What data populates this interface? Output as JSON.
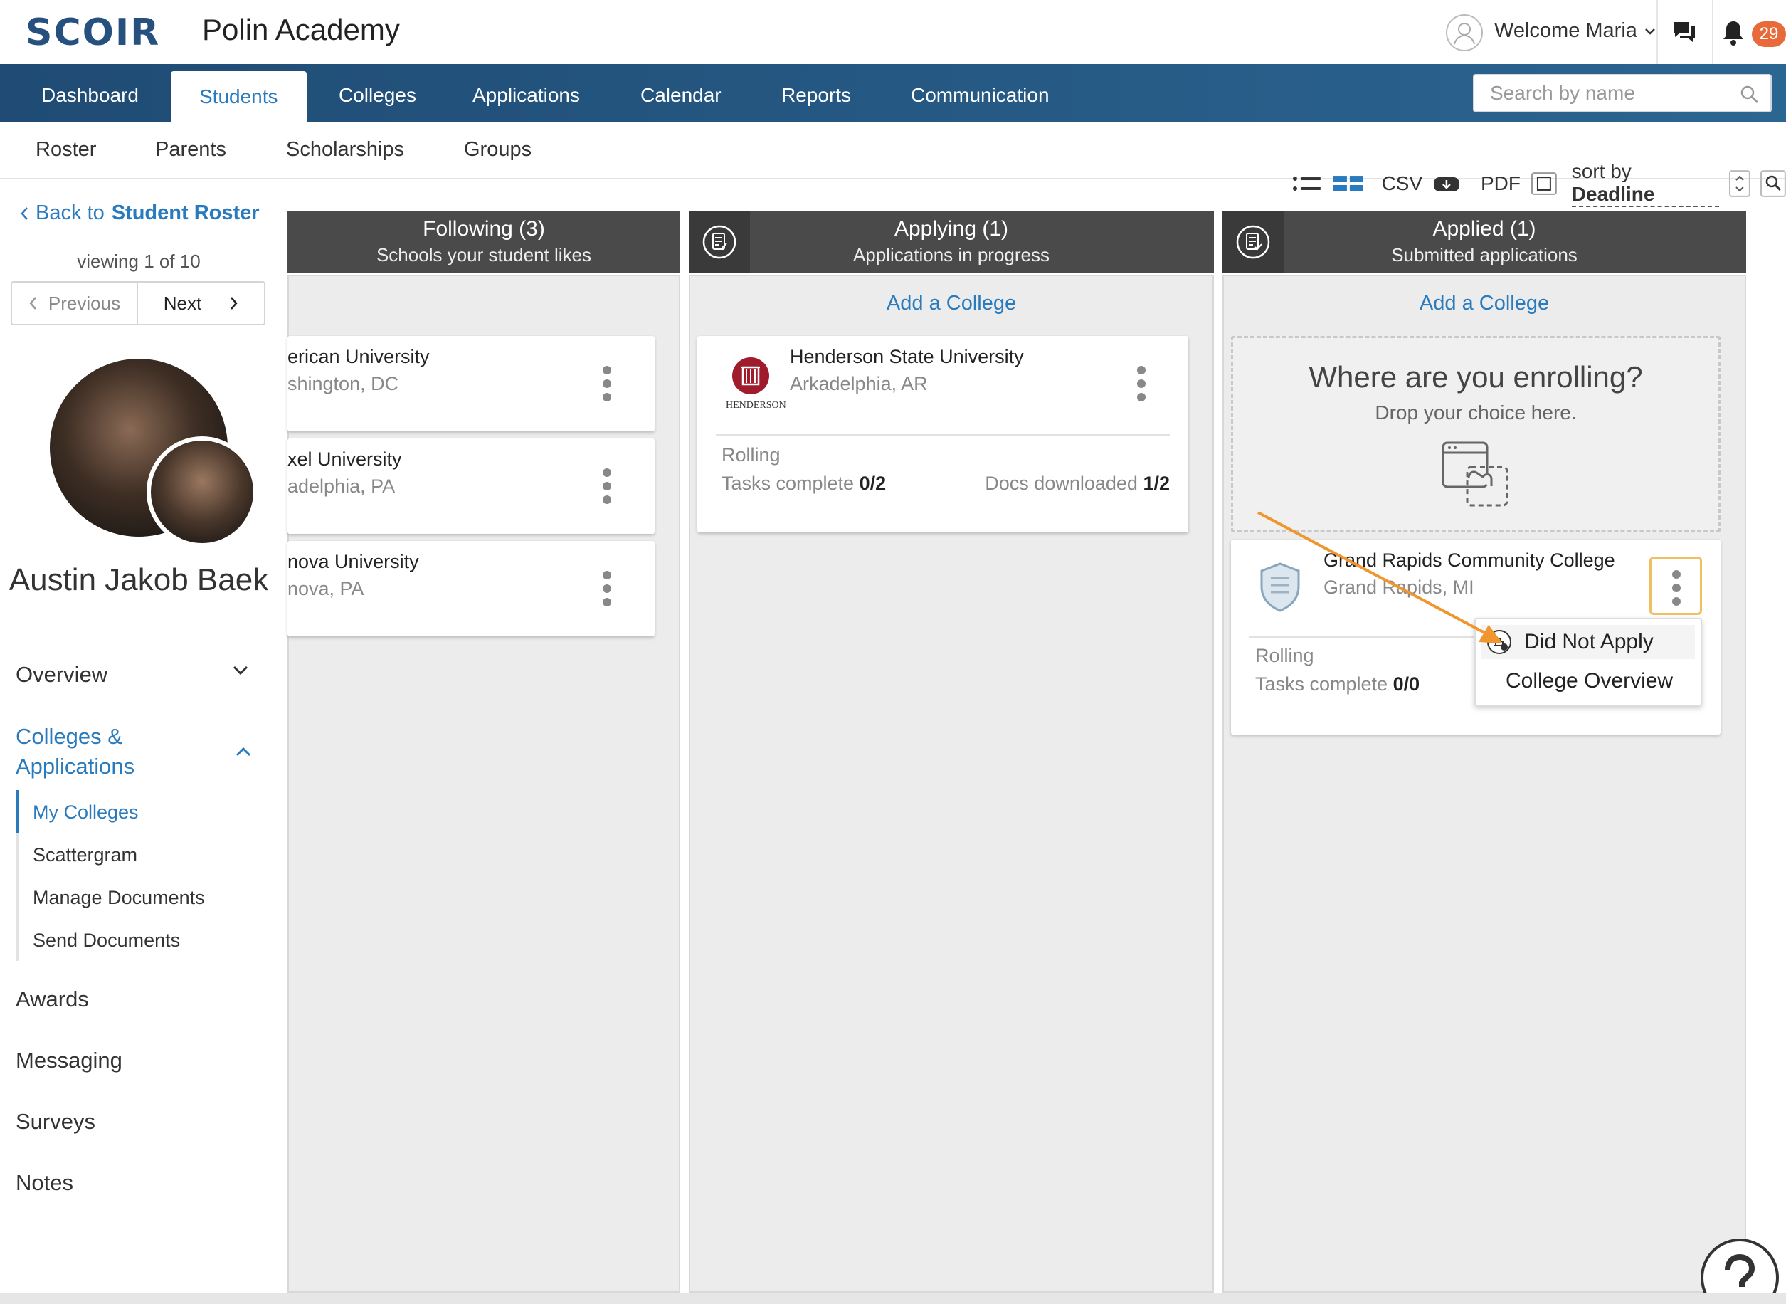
{
  "app": {
    "logo_text": "SCOIR",
    "school_name": "Polin Academy"
  },
  "user": {
    "welcome": "Welcome Maria",
    "notification_count": "29"
  },
  "main_nav": {
    "tabs": [
      {
        "label": "Dashboard"
      },
      {
        "label": "Students",
        "active": true
      },
      {
        "label": "Colleges"
      },
      {
        "label": "Applications"
      },
      {
        "label": "Calendar"
      },
      {
        "label": "Reports"
      },
      {
        "label": "Communication"
      }
    ],
    "search_placeholder": "Search by name"
  },
  "sub_nav": {
    "tabs": [
      {
        "label": "Roster"
      },
      {
        "label": "Parents"
      },
      {
        "label": "Scholarships"
      },
      {
        "label": "Groups"
      }
    ]
  },
  "sidebar": {
    "back_prefix": "Back to",
    "back_target": "Student Roster",
    "viewing": "viewing 1 of 10",
    "previous": "Previous",
    "next": "Next",
    "student_name": "Austin Jakob Baek",
    "sections": {
      "overview": "Overview",
      "colleges_apps_line1": "Colleges &",
      "colleges_apps_line2": "Applications",
      "sub_items": [
        "My Colleges",
        "Scattergram",
        "Manage Documents",
        "Send Documents"
      ],
      "awards": "Awards",
      "messaging": "Messaging",
      "surveys": "Surveys",
      "notes": "Notes"
    }
  },
  "toolbar": {
    "csv": "CSV",
    "pdf": "PDF",
    "sort_prefix": "sort by",
    "sort_value": "Deadline"
  },
  "columns": {
    "following": {
      "title": "Following (3)",
      "subtitle": "Schools your student likes",
      "cards": [
        {
          "name": "erican University",
          "location": "shington, DC"
        },
        {
          "name": "xel University",
          "location": "adelphia, PA"
        },
        {
          "name": "nova University",
          "location": "nova, PA"
        }
      ]
    },
    "applying": {
      "title": "Applying (1)",
      "subtitle": "Applications in progress",
      "add_label": "Add a College",
      "card": {
        "name": "Henderson State University",
        "location": "Arkadelphia, AR",
        "logo_text": "HENDERSON",
        "deadline": "Rolling",
        "tasks_label": "Tasks complete",
        "tasks_value": "0/2",
        "docs_label": "Docs downloaded",
        "docs_value": "1/2"
      }
    },
    "applied": {
      "title": "Applied (1)",
      "subtitle": "Submitted applications",
      "add_label": "Add a College",
      "drop_title": "Where are you enrolling?",
      "drop_sub": "Drop your choice here.",
      "card": {
        "name": "Grand Rapids Community College",
        "location": "Grand Rapids, MI",
        "deadline": "Rolling",
        "tasks_label": "Tasks complete",
        "tasks_value": "0/0"
      },
      "menu": [
        "Did Not Apply",
        "College Overview"
      ]
    }
  },
  "colors": {
    "brand": "#26507e",
    "accent": "#2a7bbd",
    "header_dark": "#4a4a4a",
    "badge": "#e86a3a",
    "annotation_arrow": "#f0962e"
  }
}
